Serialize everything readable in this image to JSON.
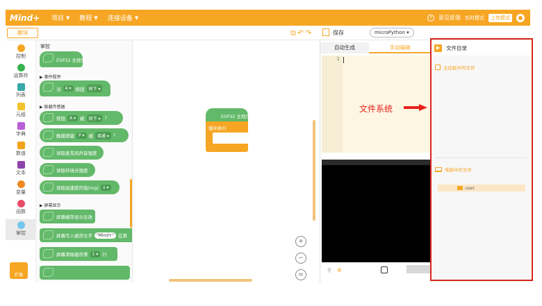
{
  "app": {
    "logo": "Mind+"
  },
  "menu": [
    {
      "label": "项目"
    },
    {
      "label": "教程"
    },
    {
      "label": "连接设备"
    }
  ],
  "top_right": {
    "feedback": "意见反馈",
    "mode_realtime": "实时模式",
    "mode_upload": "上传模式"
  },
  "toolbar": {
    "module_button": "模块",
    "save_label": "保存",
    "language": "microPython"
  },
  "categories": [
    {
      "label": "控制",
      "color": "#f6a623"
    },
    {
      "label": "运算符",
      "color": "#37b24d"
    },
    {
      "label": "列表",
      "color": "#38a9a7"
    },
    {
      "label": "元组",
      "color": "#f2c230"
    },
    {
      "label": "字典",
      "color": "#b75fd8"
    },
    {
      "label": "数值",
      "color": "#f2a21b"
    },
    {
      "label": "文本",
      "color": "#8e44ad"
    },
    {
      "label": "变量",
      "color": "#f08a24"
    },
    {
      "label": "函数",
      "color": "#e74c6a"
    },
    {
      "label": "掌控",
      "color": "#74c7ec"
    }
  ],
  "extension_label": "扩展",
  "palette": {
    "title": "掌控",
    "main_block": "ESP32 主程序",
    "sections": [
      "事件程序",
      "板载传感器",
      "屏幕显示"
    ],
    "blocks": [
      {
        "parts": [
          "当",
          "A",
          "按钮",
          "按下"
        ]
      },
      {
        "parts": [
          "按钮",
          "A",
          "被",
          "按下",
          "?"
        ]
      },
      {
        "parts": [
          "触摸按键",
          "P",
          "被",
          "接通",
          "?"
        ]
      },
      {
        "parts": [
          "读取麦克风声音强度"
        ]
      },
      {
        "parts": [
          "读取环境光强度"
        ]
      },
      {
        "parts": [
          "读取加速度的值(mg)",
          "x"
        ]
      },
      {
        "parts": [
          "屏幕缓存显示生效"
        ]
      },
      {
        "parts": [
          "屏幕写入缓存文字",
          "\"Mind+\"",
          "在第"
        ]
      },
      {
        "parts": [
          "屏幕清除缓存第",
          "1",
          "行"
        ]
      }
    ]
  },
  "workspace": {
    "main_block": "ESP32 主程序",
    "loop_block": "循环执行"
  },
  "code_panel": {
    "tab_generated": "自动生成",
    "tab_manual": "手动编辑",
    "line_number": "1"
  },
  "file_panel": {
    "title": "文件目录",
    "board_files": "主控板中的文件",
    "pc_files": "电脑中的文件",
    "folder": "user"
  },
  "annotation": {
    "text": "文件系统",
    "color": "#e8231a"
  }
}
